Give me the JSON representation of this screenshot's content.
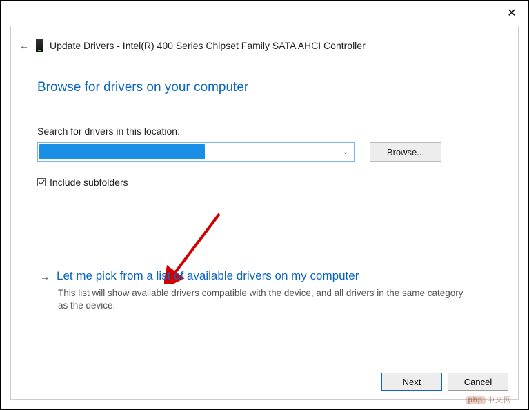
{
  "window": {
    "title": "Update Drivers - Intel(R) 400 Series Chipset Family SATA AHCI Controller"
  },
  "heading": "Browse for drivers on your computer",
  "search": {
    "label": "Search for drivers in this location:",
    "path_value": "",
    "browse_label": "Browse..."
  },
  "subfolders": {
    "label": "Include subfolders",
    "checked": true
  },
  "pick_option": {
    "title": "Let me pick from a list of available drivers on my computer",
    "description": "This list will show available drivers compatible with the device, and all drivers in the same category as the device."
  },
  "footer": {
    "next_label": "Next",
    "cancel_label": "Cancel"
  },
  "watermark": {
    "left": "php",
    "right": "中文网"
  }
}
